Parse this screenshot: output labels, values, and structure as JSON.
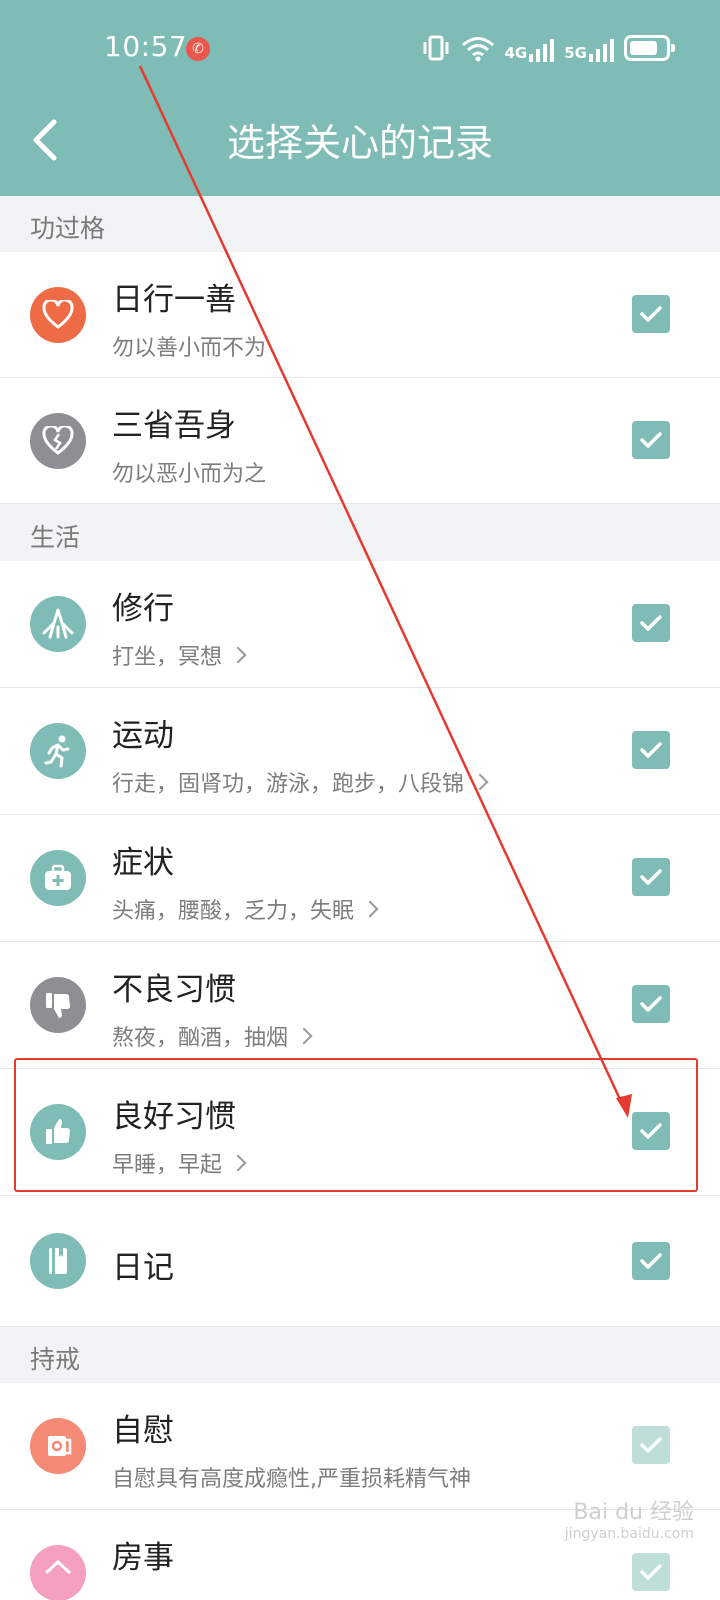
{
  "status_bar": {
    "time": "10:57",
    "network_4g": "4G",
    "network_5g": "5G",
    "battery_level": 0.8
  },
  "header": {
    "title": "选择关心的记录"
  },
  "colors": {
    "header_bg": "#7fbcb5",
    "checkbox": "#7fbcb5",
    "annotation": "#e53a30"
  },
  "sections": [
    {
      "label": "功过格",
      "items": [
        {
          "title": "日行一善",
          "subtitle": "勿以善小而不为",
          "icon": "heart-icon",
          "icon_color": "#ef6b45",
          "checked": true
        },
        {
          "title": "三省吾身",
          "subtitle": "勿以恶小而为之",
          "icon": "broken-heart-icon",
          "icon_color": "#8e8e93",
          "checked": true
        }
      ]
    },
    {
      "label": "生活",
      "items": [
        {
          "title": "修行",
          "subtitle": "打坐，冥想",
          "icon": "meditation-icon",
          "icon_color": "#7fbcb5",
          "checked": true
        },
        {
          "title": "运动",
          "subtitle": "行走，固肾功，游泳，跑步，八段锦",
          "icon": "running-icon",
          "icon_color": "#7fbcb5",
          "checked": true
        },
        {
          "title": "症状",
          "subtitle": "头痛，腰酸，乏力，失眠",
          "icon": "medkit-icon",
          "icon_color": "#7fbcb5",
          "checked": true
        },
        {
          "title": "不良习惯",
          "subtitle": "熬夜，酗酒，抽烟",
          "icon": "thumbs-down-icon",
          "icon_color": "#8e8e93",
          "checked": true
        },
        {
          "title": "良好习惯",
          "subtitle": "早睡，早起",
          "icon": "thumbs-up-icon",
          "icon_color": "#7fbcb5",
          "checked": true
        },
        {
          "title": "日记",
          "subtitle": "",
          "icon": "diary-icon",
          "icon_color": "#7fbcb5",
          "checked": true
        }
      ]
    },
    {
      "label": "持戒",
      "items": [
        {
          "title": "自慰",
          "subtitle": "自慰具有高度成瘾性,严重损耗精气神",
          "icon": "tissue-roll-icon",
          "icon_color": "#f48a76",
          "checked": true
        },
        {
          "title": "房事",
          "subtitle": "",
          "icon": "home-icon",
          "icon_color": "#f5a0c0",
          "checked": true
        }
      ]
    }
  ],
  "watermark": {
    "line1": "Bai du 经验",
    "line2": "jingyan.baidu.com"
  }
}
